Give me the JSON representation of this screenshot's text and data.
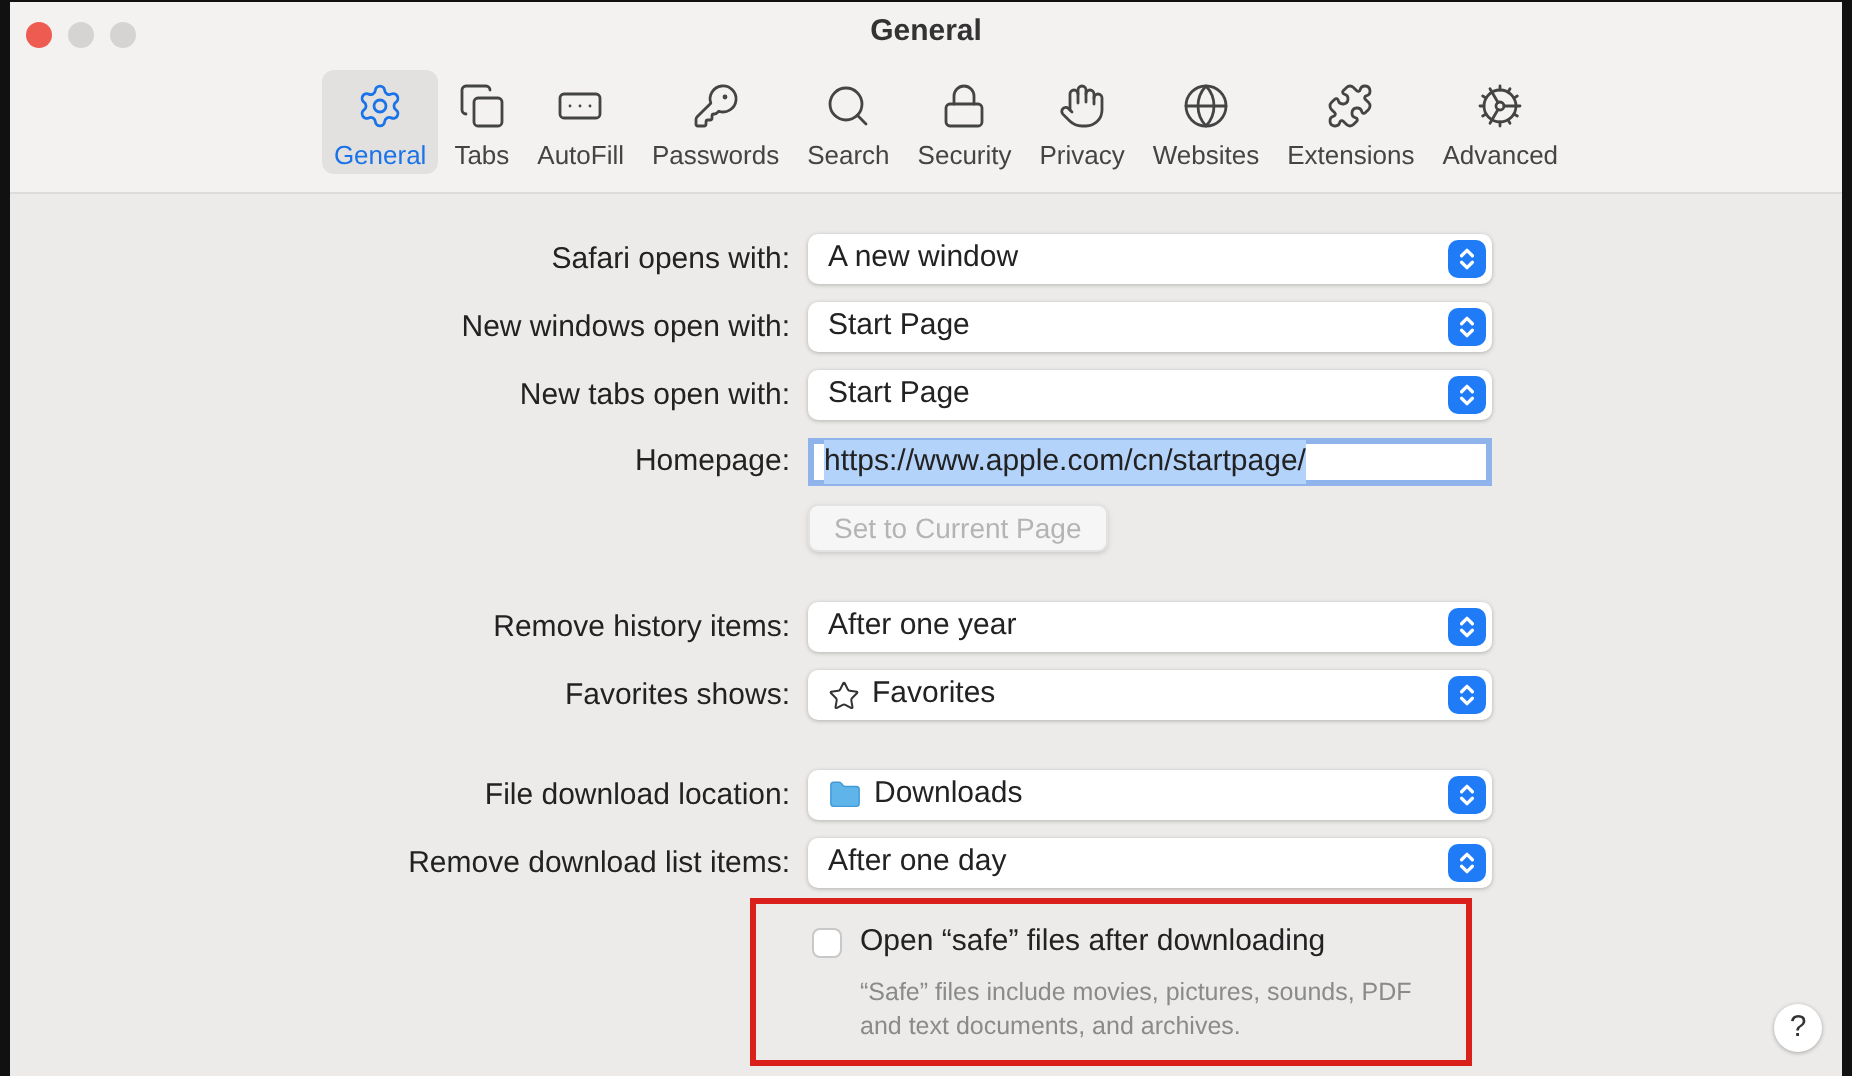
{
  "window": {
    "title": "General"
  },
  "toolbar": [
    {
      "label": "General",
      "selected": true
    },
    {
      "label": "Tabs",
      "selected": false
    },
    {
      "label": "AutoFill",
      "selected": false
    },
    {
      "label": "Passwords",
      "selected": false
    },
    {
      "label": "Search",
      "selected": false
    },
    {
      "label": "Security",
      "selected": false
    },
    {
      "label": "Privacy",
      "selected": false
    },
    {
      "label": "Websites",
      "selected": false
    },
    {
      "label": "Extensions",
      "selected": false
    },
    {
      "label": "Advanced",
      "selected": false
    }
  ],
  "sections": [
    [
      {
        "kind": "popup",
        "label": "Safari opens with:",
        "value": "A new window"
      },
      {
        "kind": "popup",
        "label": "New windows open with:",
        "value": "Start Page"
      },
      {
        "kind": "popup",
        "label": "New tabs open with:",
        "value": "Start Page"
      },
      {
        "kind": "field",
        "label": "Homepage:",
        "value": "https://www.apple.com/cn/startpage/",
        "selected": true
      },
      {
        "kind": "button",
        "value": "Set to Current Page",
        "disabled": true
      }
    ],
    [
      {
        "kind": "popup",
        "label": "Remove history items:",
        "value": "After one year"
      },
      {
        "kind": "star-popup",
        "label": "Favorites shows:",
        "value": "Favorites"
      }
    ],
    [
      {
        "kind": "folder-popup",
        "label": "File download location:",
        "value": "Downloads"
      },
      {
        "kind": "popup",
        "label": "Remove download list items:",
        "value": "After one day"
      }
    ]
  ],
  "safe_files": {
    "label": "Open “safe” files after downloading",
    "checked": false,
    "note": "“Safe” files include movies, pictures, sounds, PDF and text documents, and archives.",
    "highlighted": true
  },
  "help": {
    "label": "?"
  }
}
